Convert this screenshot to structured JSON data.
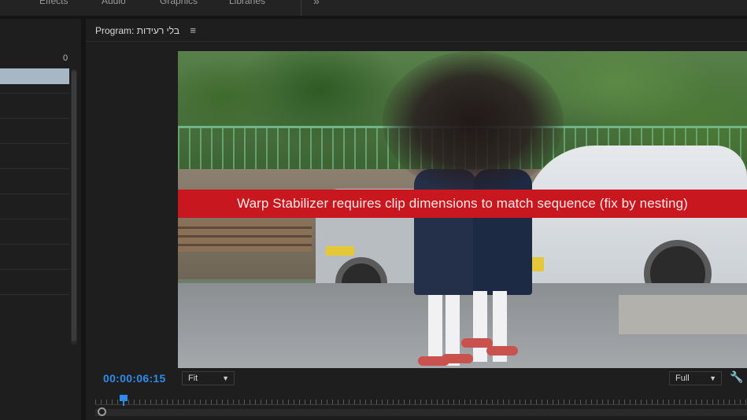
{
  "workspaces": {
    "tabs": [
      "Effects",
      "Audio",
      "Graphics",
      "Libraries"
    ],
    "overflow_icon": "double-chevron-right-icon"
  },
  "left_panel": {
    "ruler_label": "0"
  },
  "program_monitor": {
    "title": "Program: בלי רעידות",
    "menu_icon": "hamburger-menu-icon",
    "overlay_text": "Warp Stabilizer requires clip dimensions to match sequence (fix by nesting)",
    "timecode": "00:00:06:15",
    "zoom_value": "Fit",
    "resolution_value": "Full",
    "settings_icon": "wrench-icon",
    "playhead_color": "#2d8ceb",
    "overlay_color": "#c8171e"
  }
}
